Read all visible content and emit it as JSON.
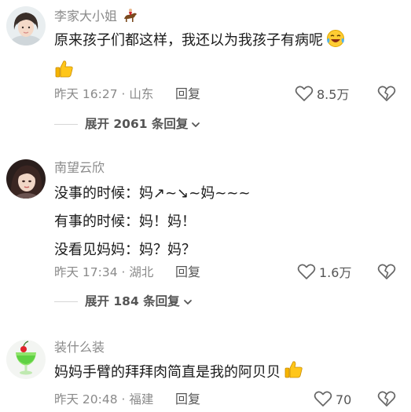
{
  "comments": [
    {
      "username": "李家大小姐",
      "badge_icon": "horse-rider-icon",
      "body_lines": [
        "原来孩子们都这样，我还以为我孩子有病呢"
      ],
      "emojis": [
        "laughing-crying-emoji",
        "thumbs-up-emoji"
      ],
      "meta": "昨天 16:27 · 山东",
      "reply_label": "回复",
      "like_count": "8.5万",
      "expand_label": "展开 2061 条回复"
    },
    {
      "username": "南望云欣",
      "body_lines": [
        "没事的时候：妈↗~↘~妈~~~",
        "有事的时候：妈！妈！",
        "没看见妈妈：妈？妈？"
      ],
      "meta": "昨天 17:34 · 湖北",
      "reply_label": "回复",
      "like_count": "1.6万",
      "expand_label": "展开 184 条回复"
    },
    {
      "username": "装什么装",
      "body_lines": [
        "妈妈手臂的拜拜肉简直是我的阿贝贝"
      ],
      "emojis": [
        "thumbs-up-emoji"
      ],
      "meta": "昨天 20:48 · 福建",
      "reply_label": "回复",
      "like_count": "70"
    }
  ],
  "colors": {
    "meta_text": "#8a8a8a",
    "action_text": "#555555",
    "thumb": "#f5b400"
  }
}
